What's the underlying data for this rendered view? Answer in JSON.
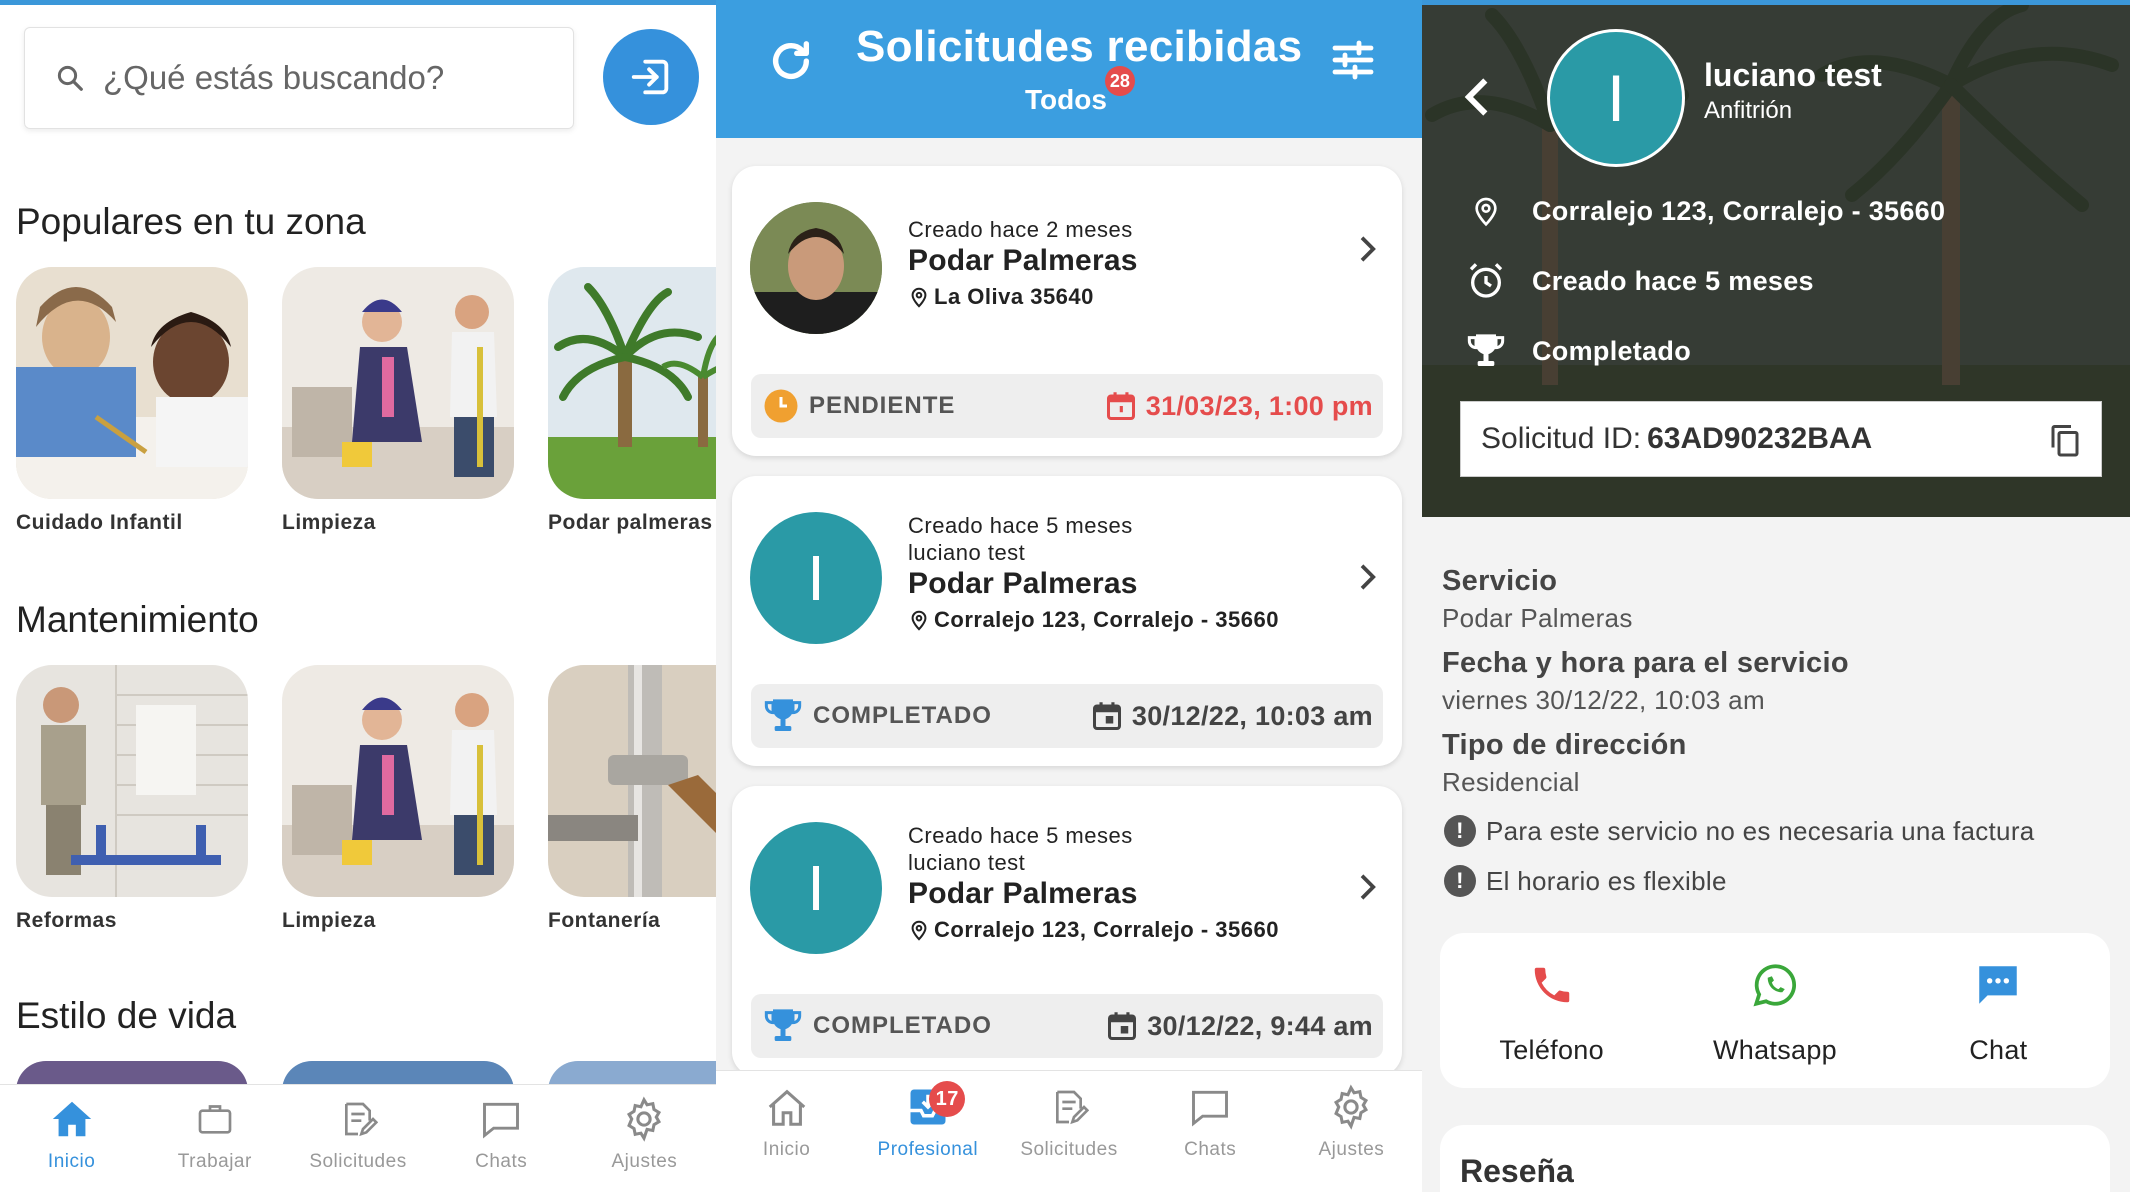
{
  "screen1": {
    "search": {
      "placeholder": "¿Qué estás buscando?"
    },
    "sections": [
      {
        "title": "Populares en tu zona",
        "tiles": [
          "Cuidado Infantil",
          "Limpieza",
          "Podar palmeras"
        ]
      },
      {
        "title": "Mantenimiento",
        "tiles": [
          "Reformas",
          "Limpieza",
          "Fontanería"
        ]
      },
      {
        "title": "Estilo de vida",
        "tiles": []
      }
    ],
    "tabs": [
      "Inicio",
      "Trabajar",
      "Solicitudes",
      "Chats",
      "Ajustes"
    ],
    "active_tab": "Inicio"
  },
  "screen2": {
    "header": {
      "title": "Solicitudes recibidas",
      "filter": "Todos",
      "count": "28"
    },
    "cards": [
      {
        "created": "Creado hace 2 meses",
        "user": "",
        "service": "Podar Palmeras",
        "location": "La Oliva 35640",
        "status": "PENDIENTE",
        "date": "31/03/23, 1:00 pm"
      },
      {
        "created": "Creado hace 5 meses",
        "user": "luciano test",
        "avatar_letter": "I",
        "service": "Podar Palmeras",
        "location": "Corralejo 123, Corralejo - 35660",
        "status": "COMPLETADO",
        "date": "30/12/22, 10:03 am"
      },
      {
        "created": "Creado hace 5 meses",
        "user": "luciano test",
        "avatar_letter": "I",
        "service": "Podar Palmeras",
        "location": "Corralejo 123, Corralejo - 35660",
        "status": "COMPLETADO",
        "date": "30/12/22, 9:44 am"
      }
    ],
    "tabs": [
      "Inicio",
      "Profesional",
      "Solicitudes",
      "Chats",
      "Ajustes"
    ],
    "active_tab": "Profesional",
    "profesional_badge": "17"
  },
  "screen3": {
    "user": {
      "name": "luciano test",
      "role": "Anfitrión",
      "avatar_letter": "I"
    },
    "address": "Corralejo 123, Corralejo - 35660",
    "created": "Creado hace 5 meses",
    "status": "Completado",
    "request_id": {
      "label": "Solicitud ID:",
      "value": "63AD90232BAA"
    },
    "details": {
      "service_label": "Servicio",
      "service_value": "Podar Palmeras",
      "datetime_label": "Fecha y hora para el servicio",
      "datetime_value": "viernes 30/12/22, 10:03 am",
      "address_type_label": "Tipo de dirección",
      "address_type_value": "Residencial"
    },
    "notes": [
      "Para este servicio no es necesaria una factura",
      "El horario es flexible"
    ],
    "actions": [
      "Teléfono",
      "Whatsapp",
      "Chat"
    ],
    "review_title": "Reseña"
  },
  "colors": {
    "primary": "#3591dc",
    "header": "#3b9ee0",
    "avatar": "#2a9aa6",
    "pending": "#f0a030",
    "danger": "#e54c4c",
    "whatsapp": "#3aa73a"
  }
}
